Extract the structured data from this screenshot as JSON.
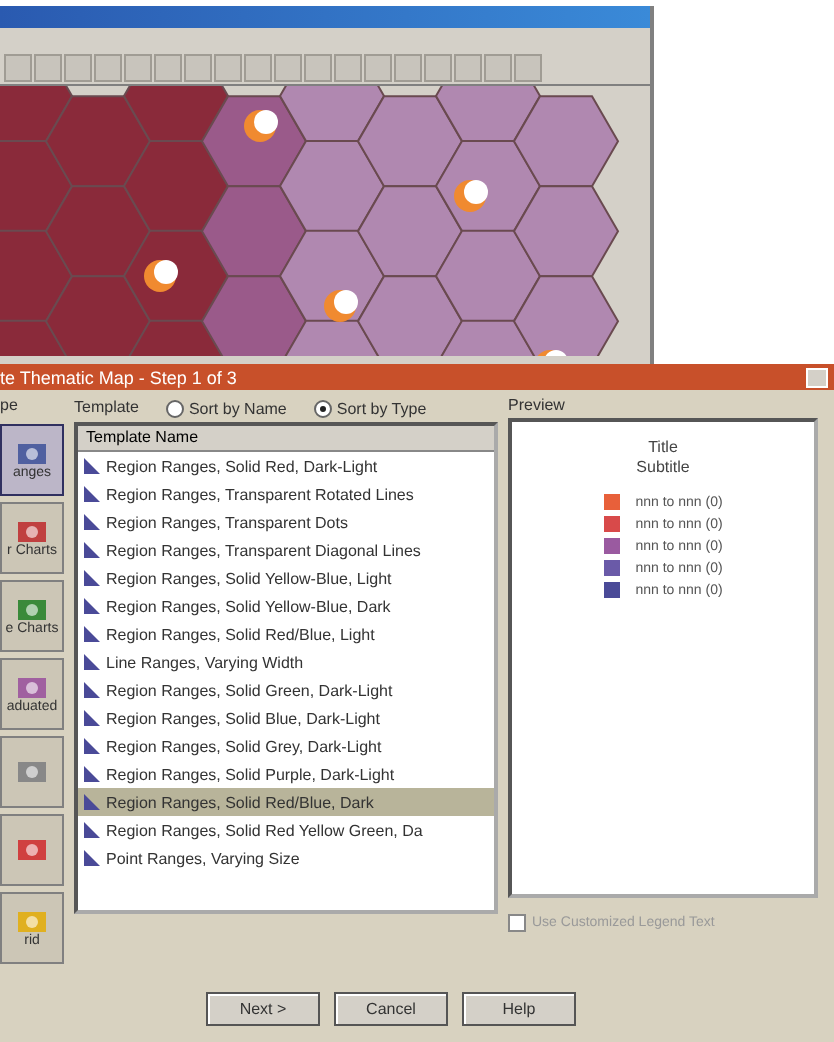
{
  "dialog": {
    "title": "te Thematic Map - Step 1 of 3",
    "type_label": "pe",
    "types": [
      {
        "kind": "ranges",
        "label": "anges",
        "selected": true
      },
      {
        "kind": "bars",
        "label": "r Charts",
        "selected": false
      },
      {
        "kind": "pies",
        "label": "e Charts",
        "selected": false
      },
      {
        "kind": "graduated",
        "label": "aduated",
        "selected": false
      },
      {
        "kind": "dots",
        "selected": false
      },
      {
        "kind": "individual",
        "selected": false
      },
      {
        "kind": "grid",
        "label": "rid",
        "selected": false
      }
    ],
    "template_label": "Template",
    "sort_options": [
      {
        "label": "Sort by Name",
        "selected": false
      },
      {
        "label": "Sort by Type",
        "selected": true
      }
    ],
    "list_header": "Template Name",
    "templates": [
      {
        "name": "Region Ranges, Solid Red, Dark-Light",
        "selected": false
      },
      {
        "name": "Region Ranges, Transparent Rotated Lines",
        "selected": false
      },
      {
        "name": "Region Ranges, Transparent Dots",
        "selected": false
      },
      {
        "name": "Region Ranges, Transparent Diagonal Lines",
        "selected": false
      },
      {
        "name": "Region Ranges, Solid Yellow-Blue, Light",
        "selected": false
      },
      {
        "name": "Region Ranges, Solid Yellow-Blue, Dark",
        "selected": false
      },
      {
        "name": "Region Ranges, Solid Red/Blue, Light",
        "selected": false
      },
      {
        "name": "Line Ranges, Varying Width",
        "selected": false
      },
      {
        "name": "Region Ranges, Solid Green, Dark-Light",
        "selected": false
      },
      {
        "name": "Region Ranges, Solid Blue, Dark-Light",
        "selected": false
      },
      {
        "name": "Region Ranges, Solid Grey, Dark-Light",
        "selected": false
      },
      {
        "name": "Region Ranges, Solid Purple, Dark-Light",
        "selected": false
      },
      {
        "name": "Region Ranges, Solid Red/Blue, Dark",
        "selected": true
      },
      {
        "name": "Region Ranges, Solid Red Yellow Green, Da",
        "selected": false
      },
      {
        "name": "Point Ranges, Varying Size",
        "selected": false
      }
    ],
    "preview_label": "Preview",
    "preview": {
      "title": "Title",
      "subtitle": "Subtitle",
      "legend": [
        {
          "text": "nnn to nnn (0)",
          "color": "#e8603a"
        },
        {
          "text": "nnn to nnn (0)",
          "color": "#d84a4a"
        },
        {
          "text": "nnn to nnn (0)",
          "color": "#9a5aa0"
        },
        {
          "text": "nnn to nnn (0)",
          "color": "#6a5aa8"
        },
        {
          "text": "nnn to nnn (0)",
          "color": "#4a4a98"
        }
      ]
    },
    "legend_checkbox": {
      "label": "Use Customized Legend Text",
      "checked": false,
      "disabled": true
    },
    "buttons": [
      "Next >",
      "Cancel",
      "Help"
    ]
  }
}
